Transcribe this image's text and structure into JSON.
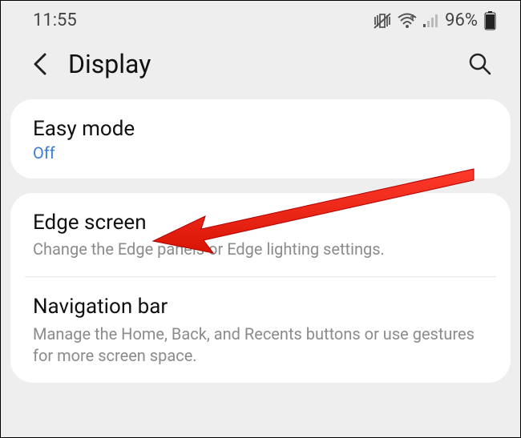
{
  "status": {
    "time": "11:55",
    "battery_pct": "96%"
  },
  "header": {
    "title": "Display"
  },
  "card1": {
    "row1": {
      "title": "Easy mode",
      "value": "Off"
    }
  },
  "card2": {
    "row1": {
      "title": "Edge screen",
      "sub": "Change the Edge panels or Edge lighting settings."
    },
    "row2": {
      "title": "Navigation bar",
      "sub": "Manage the Home, Back, and Recents buttons or use gestures for more screen space."
    }
  }
}
